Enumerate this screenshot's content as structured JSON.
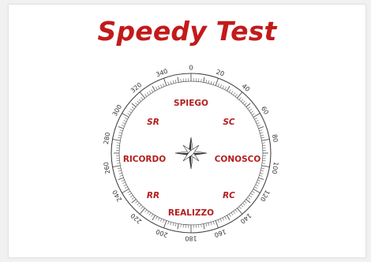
{
  "title": "Speedy Test",
  "colors": {
    "accent": "#c31a1a",
    "label": "#b51d1d"
  },
  "compass": {
    "degree_labels": [
      "0",
      "20",
      "40",
      "60",
      "80",
      "100",
      "120",
      "140",
      "160",
      "180",
      "200",
      "220",
      "240",
      "260",
      "280",
      "300",
      "320",
      "340"
    ],
    "directions": {
      "north": "SPIEGO",
      "east": "CONOSCO",
      "south": "REALIZZO",
      "west": "RICORDO"
    },
    "diagonals": {
      "north_east": "SC",
      "south_east": "RC",
      "south_west": "RR",
      "north_west": "SR"
    },
    "center_icon": "compass-rose-icon"
  }
}
